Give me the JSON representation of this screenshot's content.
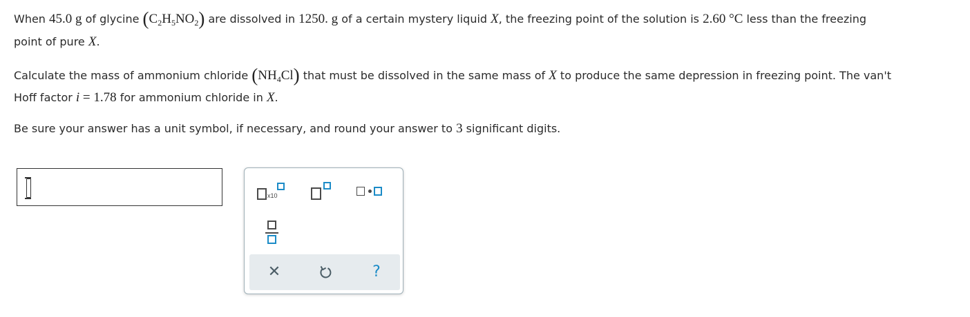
{
  "problem": {
    "p1_a": "When ",
    "mass_glycine": "45.0 g",
    "p1_b": " of glycine ",
    "glycine_formula": {
      "c": "C",
      "c_sub": "2",
      "h": "H",
      "h_sub": "5",
      "rest": "NO",
      "o_sub": "2"
    },
    "p1_c": " are dissolved in ",
    "mass_solvent": "1250. g",
    "p1_d": " of a certain mystery liquid ",
    "var_x": "X",
    "p1_e": ", the freezing point of the solution is ",
    "delta_t": "2.60 °C",
    "p1_f": " less than the freezing",
    "p1_g": "point of pure ",
    "p1_h": ".",
    "p2_a": "Calculate the mass of ammonium chloride ",
    "nh4cl_formula": {
      "a": "NH",
      "sub": "4",
      "b": "Cl"
    },
    "p2_b": " that must be dissolved in the same mass of ",
    "p2_c": " to produce the same depression in freezing point. The van't",
    "p2_d": "Hoff factor ",
    "var_i": "i",
    "i_value": " = 1.78",
    "p2_e": " for ammonium chloride in ",
    "p2_f": ".",
    "p3_a": "Be sure your answer has a unit symbol, if necessary, and round your answer to ",
    "sig_digits": "3",
    "p3_b": " significant digits."
  },
  "answer": {
    "value": ""
  },
  "toolbar": {
    "sci_notation_label": "x10",
    "icons": [
      "scientific-notation",
      "superscript",
      "multiply-dot",
      "fraction",
      "clear",
      "undo",
      "help"
    ],
    "clear_glyph": "✕",
    "help_glyph": "?",
    "accent_color": "#1b8bc7"
  }
}
